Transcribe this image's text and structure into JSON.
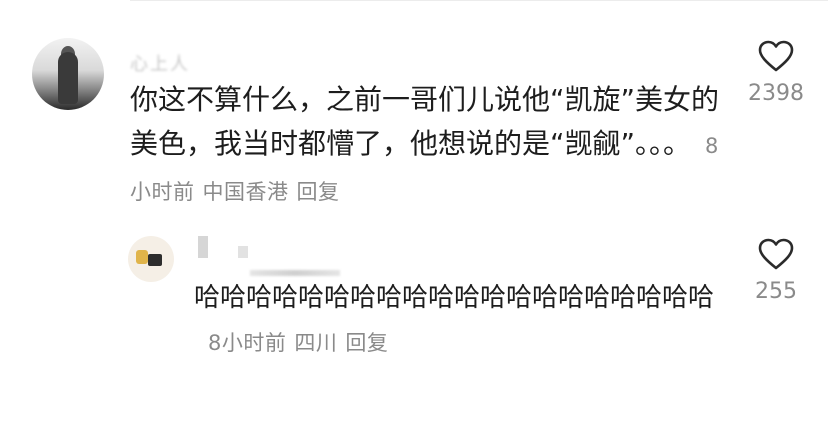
{
  "comments": [
    {
      "username": "心上人",
      "text": "你这不算什么，之前一哥们儿说他“凯旋”美女的美色，我当时都懵了，他想说的是“觊觎”。。。",
      "time": "8小时前",
      "location": "中国香港",
      "reply_label": "回复",
      "like_count": "2398",
      "like_icon": "heart-outline-icon"
    },
    {
      "text": "哈哈哈哈哈哈哈哈哈哈哈哈哈哈哈哈哈哈哈哈",
      "time": "8小时前",
      "location": "四川",
      "reply_label": "回复",
      "like_count": "255",
      "like_icon": "heart-outline-icon"
    }
  ]
}
